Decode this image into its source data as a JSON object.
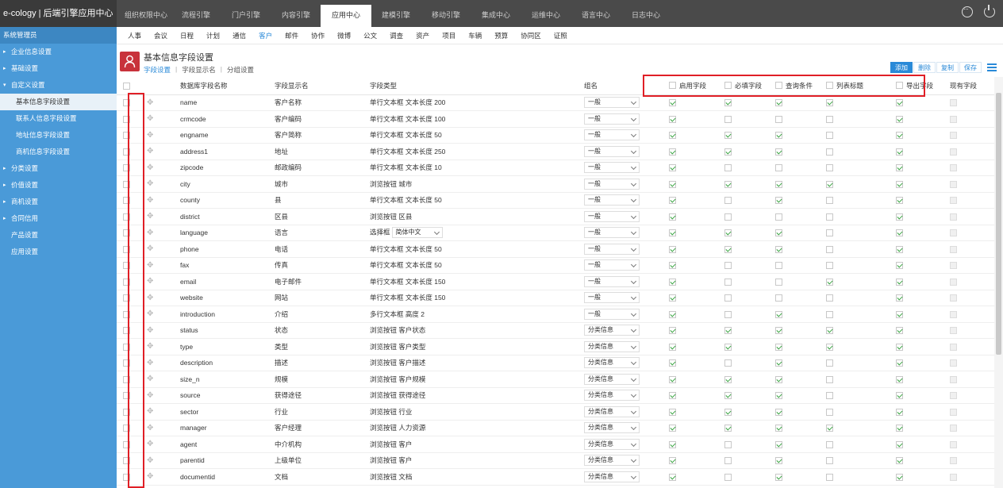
{
  "app": {
    "title": "e-cology | 后端引擎应用中心"
  },
  "topnav": [
    {
      "label": "组织权限中心"
    },
    {
      "label": "流程引擎"
    },
    {
      "label": "门户引擎"
    },
    {
      "label": "内容引擎"
    },
    {
      "label": "应用中心",
      "active": true
    },
    {
      "label": "建模引擎"
    },
    {
      "label": "移动引擎"
    },
    {
      "label": "集成中心"
    },
    {
      "label": "运维中心"
    },
    {
      "label": "语言中心"
    },
    {
      "label": "日志中心"
    }
  ],
  "sidebar": {
    "header": "系统管理员",
    "items": [
      {
        "label": "企业信息设置",
        "arrow": true
      },
      {
        "label": "基础设置",
        "arrow": true
      },
      {
        "label": "自定义设置",
        "arrow": true,
        "expanded": true
      },
      {
        "label": "基本信息字段设置",
        "sub": true,
        "active": true
      },
      {
        "label": "联系人信息字段设置",
        "sub": true
      },
      {
        "label": "地址信息字段设置",
        "sub": true
      },
      {
        "label": "商机信息字段设置",
        "sub": true
      },
      {
        "label": "分类设置",
        "arrow": true
      },
      {
        "label": "价值设置",
        "arrow": true
      },
      {
        "label": "商机设置",
        "arrow": true
      },
      {
        "label": "合同信用",
        "arrow": true
      },
      {
        "label": "产品设置",
        "arrow": false
      },
      {
        "label": "应用设置",
        "arrow": false
      }
    ]
  },
  "subnav": [
    {
      "label": "人事"
    },
    {
      "label": "会议"
    },
    {
      "label": "日程"
    },
    {
      "label": "计划"
    },
    {
      "label": "通信"
    },
    {
      "label": "客户",
      "active": true
    },
    {
      "label": "邮件"
    },
    {
      "label": "协作"
    },
    {
      "label": "微博"
    },
    {
      "label": "公文"
    },
    {
      "label": "调查"
    },
    {
      "label": "资产"
    },
    {
      "label": "项目"
    },
    {
      "label": "车辆"
    },
    {
      "label": "预算"
    },
    {
      "label": "协同区"
    },
    {
      "label": "证照"
    }
  ],
  "page": {
    "title": "基本信息字段设置",
    "tabs": [
      {
        "label": "字段设置",
        "active": true
      },
      {
        "label": "字段显示名"
      },
      {
        "label": "分组设置"
      }
    ],
    "actions": {
      "add": "添加",
      "delete": "删除",
      "copy": "复制",
      "save": "保存"
    }
  },
  "table": {
    "headers": {
      "db_name": "数据库字段名称",
      "display_name": "字段显示名",
      "type": "字段类型",
      "group": "组名",
      "enable": "启用字段",
      "required": "必填字段",
      "query": "查询条件",
      "list_title": "列表标题",
      "export": "导出字段",
      "existing": "现有字段"
    },
    "rows": [
      {
        "db": "name",
        "disp": "客户名称",
        "type": "单行文本框 文本长度 200",
        "group": "一般",
        "c": [
          1,
          1,
          1,
          1,
          1
        ]
      },
      {
        "db": "crmcode",
        "disp": "客户编码",
        "type": "单行文本框 文本长度 100",
        "group": "一般",
        "c": [
          1,
          0,
          0,
          0,
          1
        ]
      },
      {
        "db": "engname",
        "disp": "客户简称",
        "type": "单行文本框 文本长度 50",
        "group": "一般",
        "c": [
          1,
          1,
          1,
          0,
          1
        ]
      },
      {
        "db": "address1",
        "disp": "地址",
        "type": "单行文本框 文本长度 250",
        "group": "一般",
        "c": [
          1,
          1,
          1,
          0,
          1
        ]
      },
      {
        "db": "zipcode",
        "disp": "邮政编码",
        "type": "单行文本框 文本长度 10",
        "group": "一般",
        "c": [
          1,
          0,
          0,
          0,
          1
        ]
      },
      {
        "db": "city",
        "disp": "城市",
        "type": "浏览按钮 城市",
        "group": "一般",
        "c": [
          1,
          1,
          1,
          1,
          1
        ]
      },
      {
        "db": "county",
        "disp": "县",
        "type": "单行文本框 文本长度 50",
        "group": "一般",
        "c": [
          1,
          0,
          1,
          0,
          1
        ]
      },
      {
        "db": "district",
        "disp": "区县",
        "type": "浏览按钮 区县",
        "group": "一般",
        "c": [
          1,
          0,
          0,
          0,
          1
        ]
      },
      {
        "db": "language",
        "disp": "语言",
        "type": "选择框",
        "type_select": "简体中文",
        "group": "一般",
        "c": [
          1,
          1,
          1,
          0,
          1
        ]
      },
      {
        "db": "phone",
        "disp": "电话",
        "type": "单行文本框 文本长度 50",
        "group": "一般",
        "c": [
          1,
          1,
          1,
          0,
          1
        ]
      },
      {
        "db": "fax",
        "disp": "传真",
        "type": "单行文本框 文本长度 50",
        "group": "一般",
        "c": [
          1,
          0,
          0,
          0,
          1
        ]
      },
      {
        "db": "email",
        "disp": "电子邮件",
        "type": "单行文本框 文本长度 150",
        "group": "一般",
        "c": [
          1,
          0,
          0,
          1,
          1
        ]
      },
      {
        "db": "website",
        "disp": "网站",
        "type": "单行文本框 文本长度 150",
        "group": "一般",
        "c": [
          1,
          0,
          0,
          0,
          1
        ]
      },
      {
        "db": "introduction",
        "disp": "介绍",
        "type": "多行文本框 高度 2",
        "group": "一般",
        "c": [
          1,
          0,
          1,
          0,
          1
        ]
      },
      {
        "db": "status",
        "disp": "状态",
        "type": "浏览按钮 客户状态",
        "group": "分类信息",
        "c": [
          1,
          1,
          1,
          1,
          1
        ]
      },
      {
        "db": "type",
        "disp": "类型",
        "type": "浏览按钮 客户类型",
        "group": "分类信息",
        "c": [
          1,
          1,
          1,
          1,
          1
        ]
      },
      {
        "db": "description",
        "disp": "描述",
        "type": "浏览按钮 客户描述",
        "group": "分类信息",
        "c": [
          1,
          0,
          1,
          0,
          1
        ]
      },
      {
        "db": "size_n",
        "disp": "规模",
        "type": "浏览按钮 客户规模",
        "group": "分类信息",
        "c": [
          1,
          1,
          1,
          0,
          1
        ]
      },
      {
        "db": "source",
        "disp": "获得途径",
        "type": "浏览按钮 获得途径",
        "group": "分类信息",
        "c": [
          1,
          1,
          1,
          0,
          1
        ]
      },
      {
        "db": "sector",
        "disp": "行业",
        "type": "浏览按钮 行业",
        "group": "分类信息",
        "c": [
          1,
          1,
          1,
          0,
          1
        ]
      },
      {
        "db": "manager",
        "disp": "客户经理",
        "type": "浏览按钮 人力资源",
        "group": "分类信息",
        "c": [
          1,
          1,
          1,
          1,
          1
        ]
      },
      {
        "db": "agent",
        "disp": "中介机构",
        "type": "浏览按钮 客户",
        "group": "分类信息",
        "c": [
          1,
          0,
          1,
          0,
          1
        ]
      },
      {
        "db": "parentid",
        "disp": "上级单位",
        "type": "浏览按钮 客户",
        "group": "分类信息",
        "c": [
          1,
          0,
          1,
          0,
          1
        ]
      },
      {
        "db": "documentid",
        "disp": "文档",
        "type": "浏览按钮 文档",
        "group": "分类信息",
        "c": [
          1,
          0,
          1,
          0,
          1
        ]
      }
    ]
  },
  "colors": {
    "accent": "#2a8ad8",
    "sidebar": "#4a9ad8",
    "highlight": "#e01f26",
    "check": "#35a23d",
    "topbar": "#4a4a4a"
  }
}
